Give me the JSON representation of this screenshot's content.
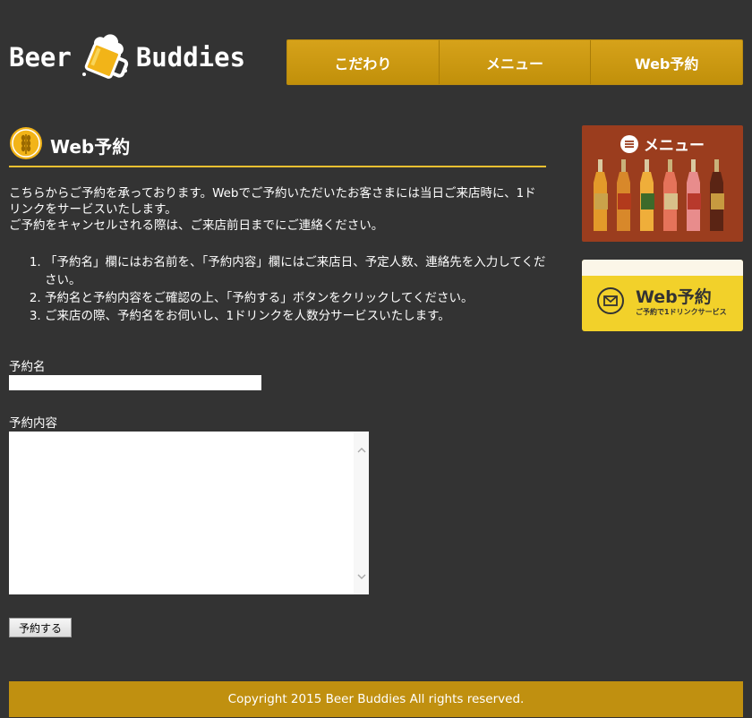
{
  "header": {
    "logo_left": "Beer",
    "logo_right": "Buddies",
    "nav": [
      "こだわり",
      "メニュー",
      "Web予約"
    ]
  },
  "main": {
    "title": "Web予約",
    "intro": [
      "こちらからご予約を承っております。Webでご予約いただいたお客さまには当日ご来店時に、1ドリンクをサービスいたします。",
      "ご予約をキャンセルされる際は、ご来店前日までにご連絡ください。"
    ],
    "steps": [
      "「予約名」欄にはお名前を、「予約内容」欄にはご来店日、予定人数、連絡先を入力してください。",
      "予約名と予約内容をご確認の上、「予約する」ボタンをクリックしてください。",
      "ご来店の際、予約名をお伺いし、1ドリンクを人数分サービスいたします。"
    ]
  },
  "form": {
    "name_label": "予約名",
    "name_value": "",
    "content_label": "予約内容",
    "content_value": "",
    "submit_label": "予約する"
  },
  "sidebar": {
    "menu_banner_title": "メニュー",
    "reserve_banner_title": "Web予約",
    "reserve_banner_sub": "ご予約で1ドリンクサービス"
  },
  "footer": {
    "copyright": "Copyright 2015 Beer Buddies All rights reserved."
  },
  "colors": {
    "background": "#333333",
    "accent": "#c09010",
    "menu_banner": "#9b3d1e",
    "reserve_banner": "#f2d12a"
  }
}
